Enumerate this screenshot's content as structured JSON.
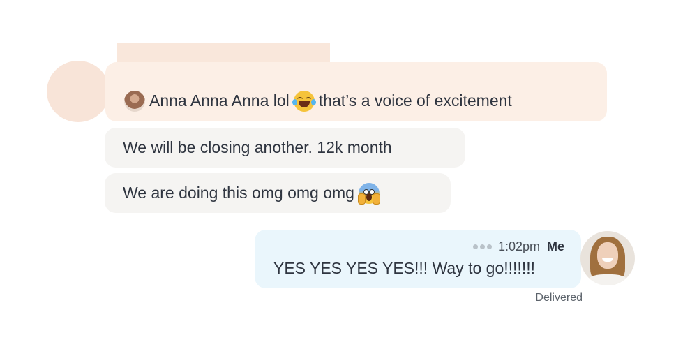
{
  "thread": {
    "incoming": {
      "highlighted_message": {
        "before_emoji": "Anna Anna Anna lol",
        "emoji_icon": "face-with-tears-of-joy-icon",
        "after_emoji": "that’s a voice of excitement"
      },
      "messages": [
        {
          "text": "We will be closing another. 12k month"
        },
        {
          "text": "We are doing this omg omg omg",
          "emoji_icon": "face-screaming-in-fear-icon"
        }
      ]
    },
    "outgoing": {
      "time": "1:02pm",
      "sender": "Me",
      "text": "YES YES YES YES!!! Way to go!!!!!!!",
      "status": "Delivered"
    }
  },
  "colors": {
    "incoming_highlight_bg": "#fcefe6",
    "incoming_bubble_bg": "#f5f4f2",
    "outgoing_bubble_bg": "#eaf6fc",
    "redaction": "#f9e7db"
  }
}
